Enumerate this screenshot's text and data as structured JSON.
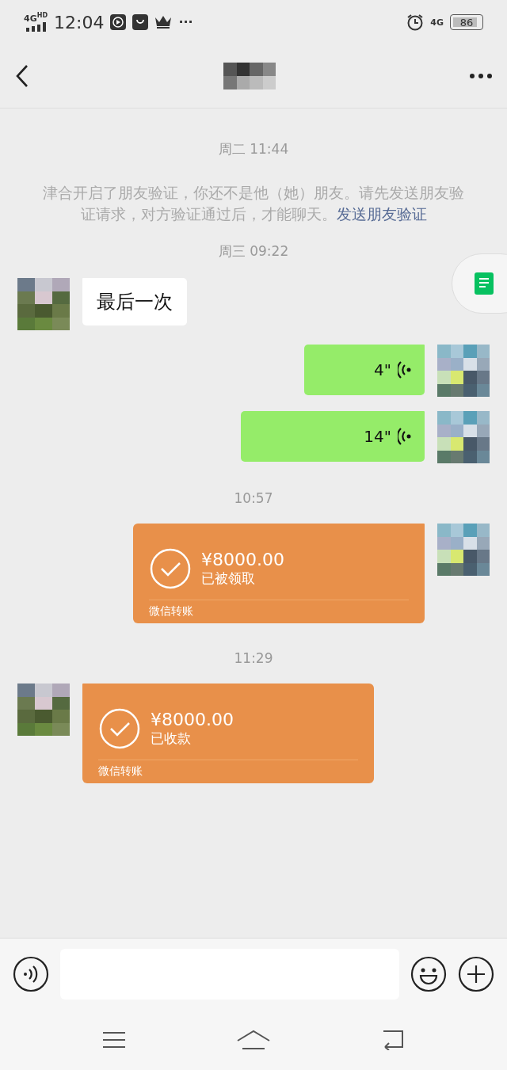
{
  "status_bar": {
    "signal_label": "4G",
    "signal_hd": "HD",
    "time": "12:04",
    "more": "···",
    "data_label": "4G",
    "battery": "86"
  },
  "messages": [
    {
      "kind": "time",
      "text": "周二 11:44"
    },
    {
      "kind": "system",
      "text": "津合开启了朋友验证，你还不是他（她）朋友。请先发送朋友验证请求，对方验证通过后，才能聊天。",
      "link": "发送朋友验证"
    },
    {
      "kind": "time",
      "text": "周三 09:22"
    },
    {
      "kind": "text",
      "sent": false,
      "text": "最后一次"
    },
    {
      "kind": "voice",
      "sent": true,
      "duration": "4\""
    },
    {
      "kind": "voice",
      "sent": true,
      "duration": "14\""
    },
    {
      "kind": "time",
      "text": "10:57"
    },
    {
      "kind": "transfer",
      "sent": true,
      "amount": "¥8000.00",
      "status": "已被领取",
      "footer": "微信转账"
    },
    {
      "kind": "time",
      "text": "11:29"
    },
    {
      "kind": "transfer",
      "sent": false,
      "amount": "¥8000.00",
      "status": "已收款",
      "footer": "微信转账"
    }
  ]
}
